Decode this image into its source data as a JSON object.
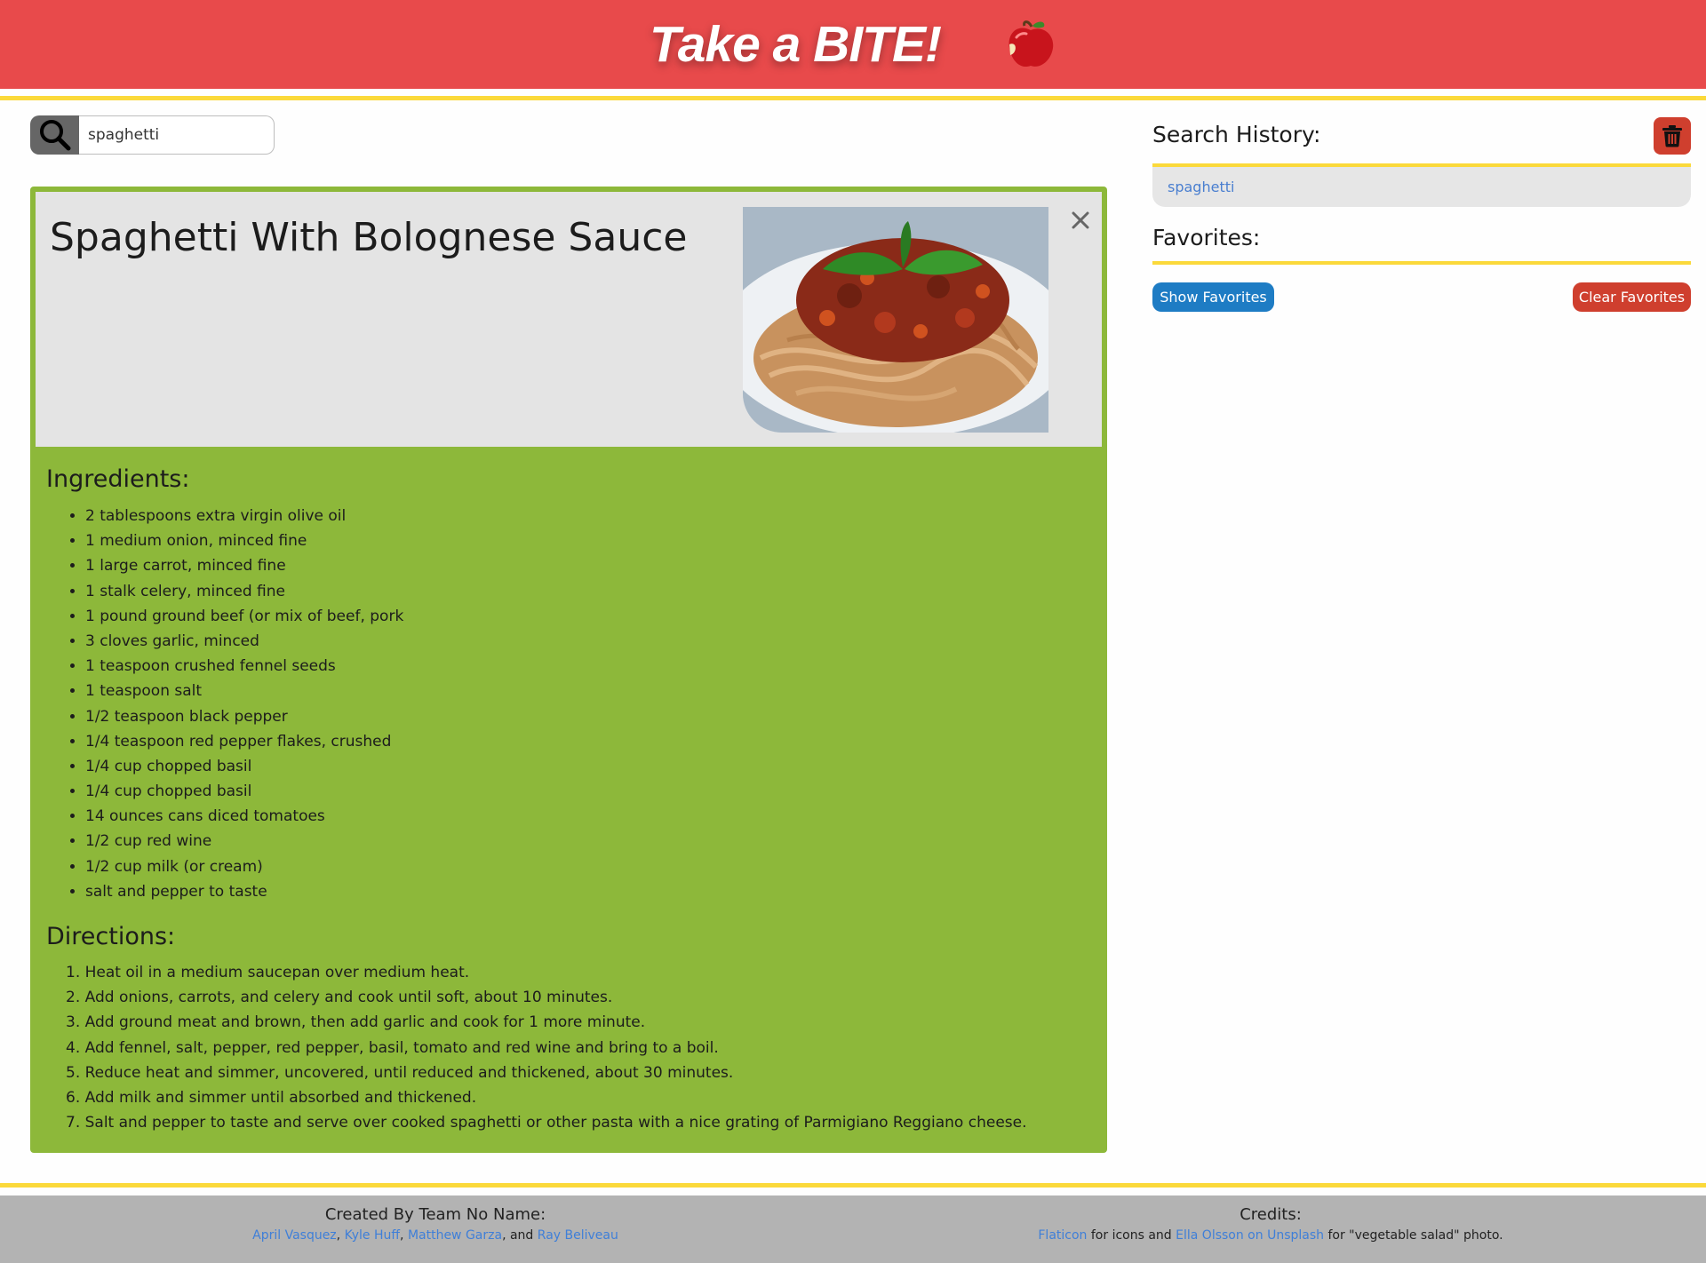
{
  "header": {
    "title": "Take a BITE!",
    "logo_icon": "apple-icon"
  },
  "search": {
    "value": "spaghetti",
    "button_icon": "search-icon"
  },
  "recipe": {
    "title": "Spaghetti With Bolognese Sauce",
    "photo_alt": "Spaghetti with bolognese sauce",
    "close_icon": "close-icon",
    "ingredients_heading": "Ingredients:",
    "ingredients": [
      "2 tablespoons extra virgin olive oil",
      "1 medium onion, minced fine",
      "1 large carrot, minced fine",
      "1 stalk celery, minced fine",
      "1 pound ground beef (or mix of beef, pork",
      "3 cloves garlic, minced",
      "1 teaspoon crushed fennel seeds",
      "1 teaspoon salt",
      "1/2 teaspoon black pepper",
      "1/4 teaspoon red pepper flakes, crushed",
      "1/4 cup chopped basil",
      "1/4 cup chopped basil",
      "14 ounces cans diced tomatoes",
      "1/2 cup red wine",
      "1/2 cup milk (or cream)",
      "salt and pepper to taste"
    ],
    "directions_heading": "Directions:",
    "directions": [
      "1. Heat oil in a medium saucepan over medium heat.",
      "2. Add onions, carrots, and celery and cook until soft, about 10 minutes.",
      "3. Add ground meat and brown, then add garlic and cook for 1 more minute.",
      "4. Add fennel, salt, pepper, red pepper, basil, tomato and red wine and bring to a boil.",
      "5. Reduce heat and simmer, uncovered, until reduced and thickened, about 30 minutes.",
      "6. Add milk and simmer until absorbed and thickened.",
      "7. Salt and pepper to taste and serve over cooked spaghetti or other pasta with a nice grating of Parmigiano Reggiano cheese."
    ]
  },
  "sidebar": {
    "history_heading": "Search History:",
    "trash_icon": "trash-icon",
    "history_items": [
      "spaghetti"
    ],
    "favorites_heading": "Favorites:",
    "show_favorites_label": "Show Favorites",
    "clear_favorites_label": "Clear Favorites"
  },
  "footer": {
    "created_title": "Created By Team No Name:",
    "authors": [
      "April Vasquez",
      "Kyle Huff",
      "Matthew Garza",
      "Ray Beliveau"
    ],
    "sep_comma": ", ",
    "sep_and": ", and ",
    "credits_title": "Credits:",
    "credit_link_1": "Flaticon",
    "credit_text_1": " for icons and ",
    "credit_link_2": "Ella Olsson on Unsplash",
    "credit_text_2": " for \"vegetable salad\" photo."
  },
  "colors": {
    "header_bg": "#e84a4b",
    "accent_yellow": "#fbd93a",
    "card_green": "#8db83a",
    "card_top_gray": "#e4e4e4",
    "button_blue": "#1e7cc4",
    "button_red": "#cf3f2e",
    "link_blue": "#3f7fd8",
    "footer_gray": "#b3b3b3"
  }
}
